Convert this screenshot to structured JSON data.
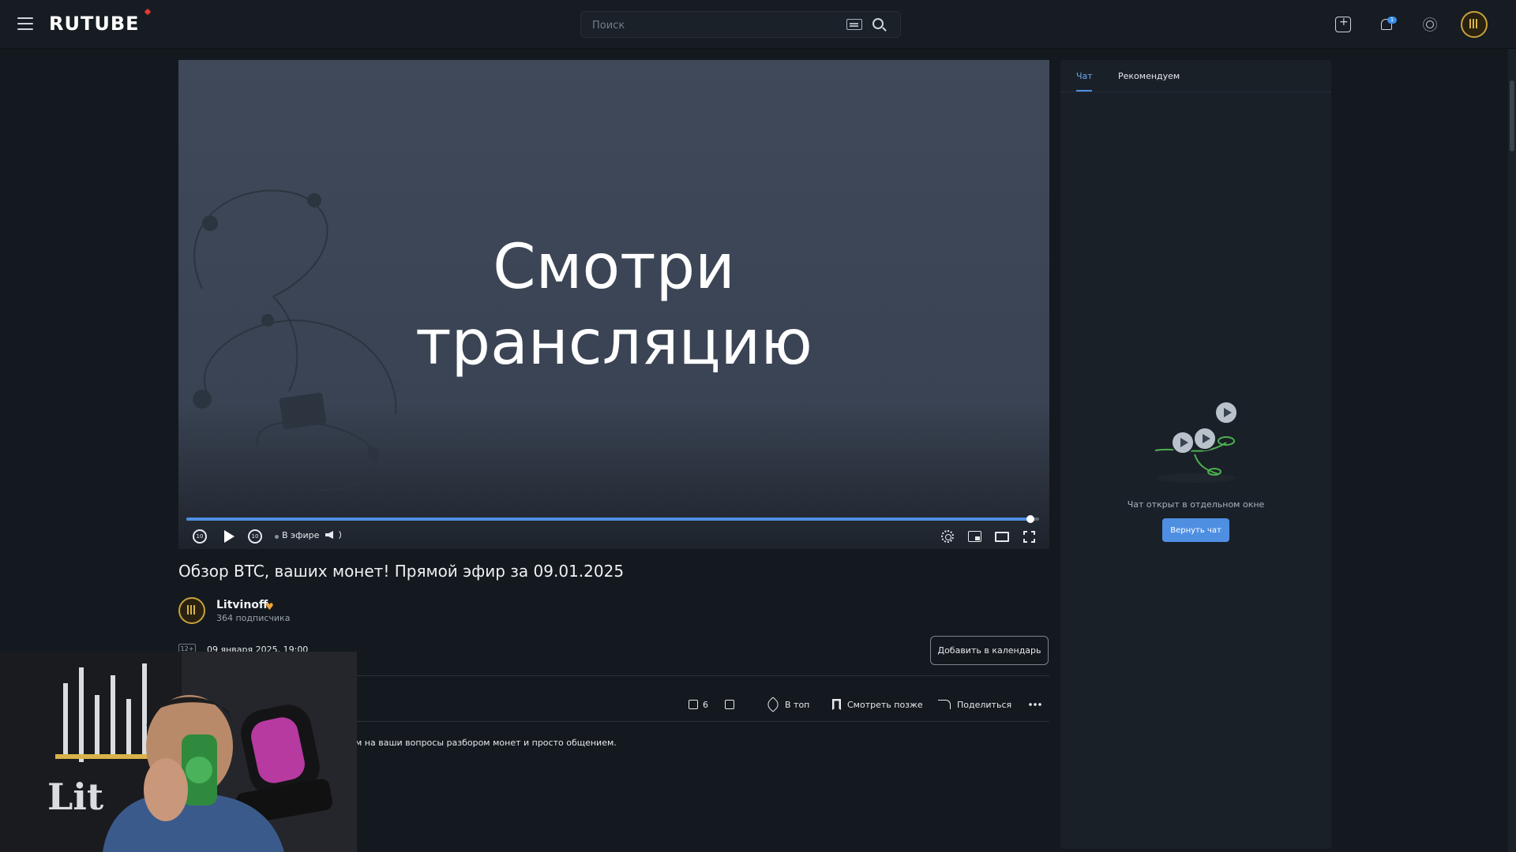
{
  "header": {
    "logo": "RUTUBE",
    "search_placeholder": "Поиск",
    "notification_count": "1"
  },
  "player": {
    "overlay_title_line1": "Смотри",
    "overlay_title_line2": "трансляцию",
    "live_label": "В эфире",
    "seek_back_label": "10",
    "seek_fwd_label": "10",
    "progress_fraction": 0.99
  },
  "video": {
    "title": "Обзор BTC, ваших монет! Прямой эфир за 09.01.2025",
    "channel_name": "Litvinoff",
    "subscribers": "364 подписчика",
    "age_rating": "12+",
    "date": "09 января 2025, 19:00",
    "add_calendar_label": "Добавить в календарь",
    "like_count": "6",
    "top_label": "В топ",
    "watch_later_label": "Смотреть позже",
    "share_label": "Поделиться",
    "description": "м на ваши вопросы разбором монет и просто общением."
  },
  "sidebar": {
    "tab_chat": "Чат",
    "tab_recommended": "Рекомендуем",
    "chat_status": "Чат открыт в отдельном окне",
    "return_chat_label": "Вернуть чат"
  },
  "colors": {
    "accent": "#4f8fe2",
    "background": "#14191f",
    "player_bg": "#3f4959",
    "verified_heart": "#e8a53a"
  }
}
